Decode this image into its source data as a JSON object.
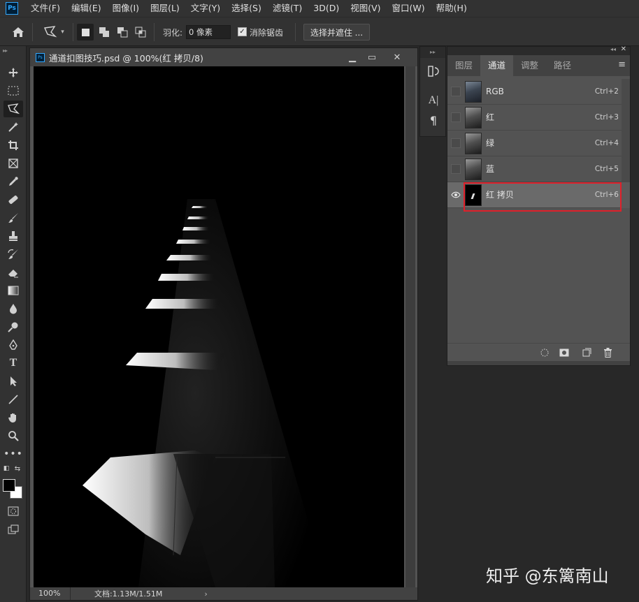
{
  "app": {
    "logo": "Ps"
  },
  "menu": [
    "文件(F)",
    "编辑(E)",
    "图像(I)",
    "图层(L)",
    "文字(Y)",
    "选择(S)",
    "滤镜(T)",
    "3D(D)",
    "视图(V)",
    "窗口(W)",
    "帮助(H)"
  ],
  "options": {
    "feather_label": "羽化:",
    "feather_value": "0 像素",
    "antialias_label": "消除锯齿",
    "antialias_checked": true,
    "select_mask_label": "选择并遮住 ..."
  },
  "tools": [
    "move-icon",
    "marquee-icon",
    "polygonal-lasso-icon",
    "magic-wand-icon",
    "crop-icon",
    "frame-icon",
    "eyedropper-icon",
    "healing-brush-icon",
    "brush-icon",
    "stamp-icon",
    "history-brush-icon",
    "eraser-icon",
    "gradient-icon",
    "blur-icon",
    "dodge-icon",
    "pen-icon",
    "type-icon",
    "path-select-icon",
    "line-icon",
    "hand-icon",
    "zoom-icon",
    "more-icon"
  ],
  "document": {
    "title": "通道扣图技巧.psd @ 100%(红 拷贝/8)",
    "zoom": "100%",
    "info": "文档:1.13M/1.51M"
  },
  "panel": {
    "tabs": [
      "图层",
      "通道",
      "调整",
      "路径"
    ],
    "active_tab": "通道",
    "channels": [
      {
        "name": "RGB",
        "shortcut": "Ctrl+2",
        "visible": false
      },
      {
        "name": "红",
        "shortcut": "Ctrl+3",
        "visible": false
      },
      {
        "name": "绿",
        "shortcut": "Ctrl+4",
        "visible": false
      },
      {
        "name": "蓝",
        "shortcut": "Ctrl+5",
        "visible": false
      },
      {
        "name": "红 拷贝",
        "shortcut": "Ctrl+6",
        "visible": true,
        "selected": true
      }
    ]
  },
  "watermark": "知乎 @东篱南山",
  "colors": {
    "accent_ps": "#31a8ff",
    "highlight_box": "#e0202a"
  }
}
